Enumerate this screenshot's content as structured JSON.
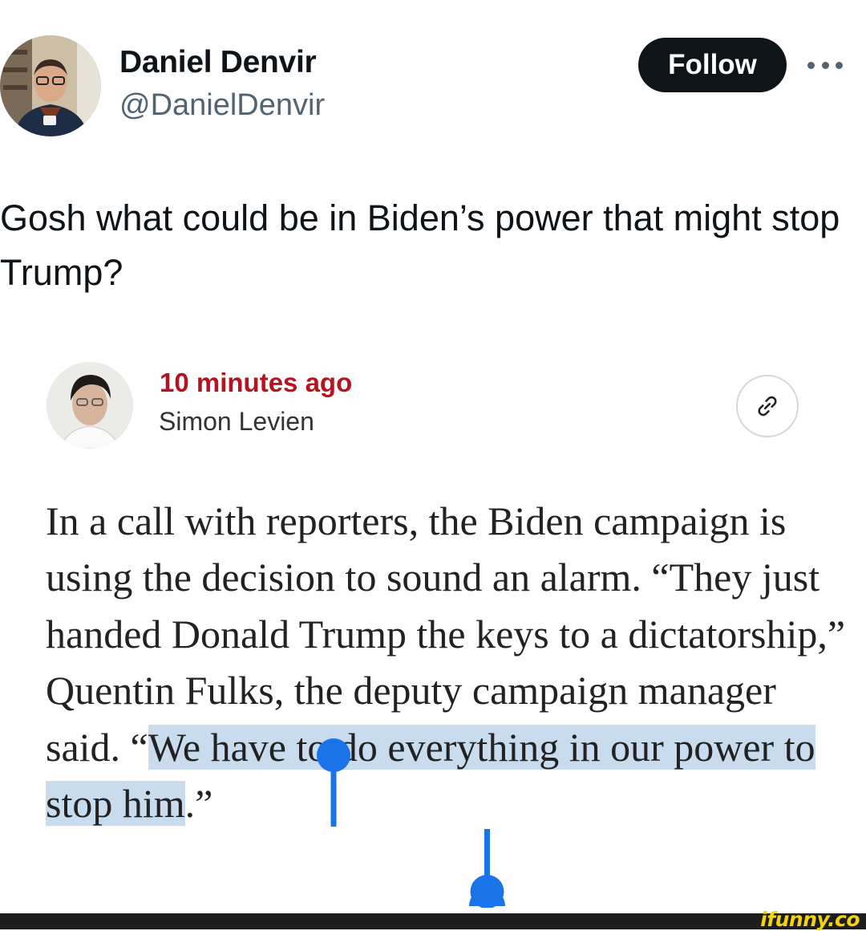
{
  "tweet": {
    "author": {
      "display_name": "Daniel Denvir",
      "handle": "@DanielDenvir",
      "avatar_icon": "profile-photo"
    },
    "follow_label": "Follow",
    "more_icon": "ellipsis-icon",
    "text": "Gosh what could be in Biden’s power that might stop Trump?"
  },
  "embedded_article": {
    "time_ago": "10 minutes ago",
    "time_color": "#b3141f",
    "byline": "Simon Levien",
    "link_icon": "link-icon",
    "body_plain": "In a call with reporters, the Biden campaign is using the decision to sound an alarm. “They just handed Donald Trump the keys to a dictatorship,” Quentin Fulks, the deputy campaign manager said. “",
    "body_selected": "We have to do everything in our power to stop him",
    "body_tail": ".”",
    "selection_color": "#c8dcee",
    "handle_color": "#1a73e8"
  },
  "watermark": "ifunny.co"
}
